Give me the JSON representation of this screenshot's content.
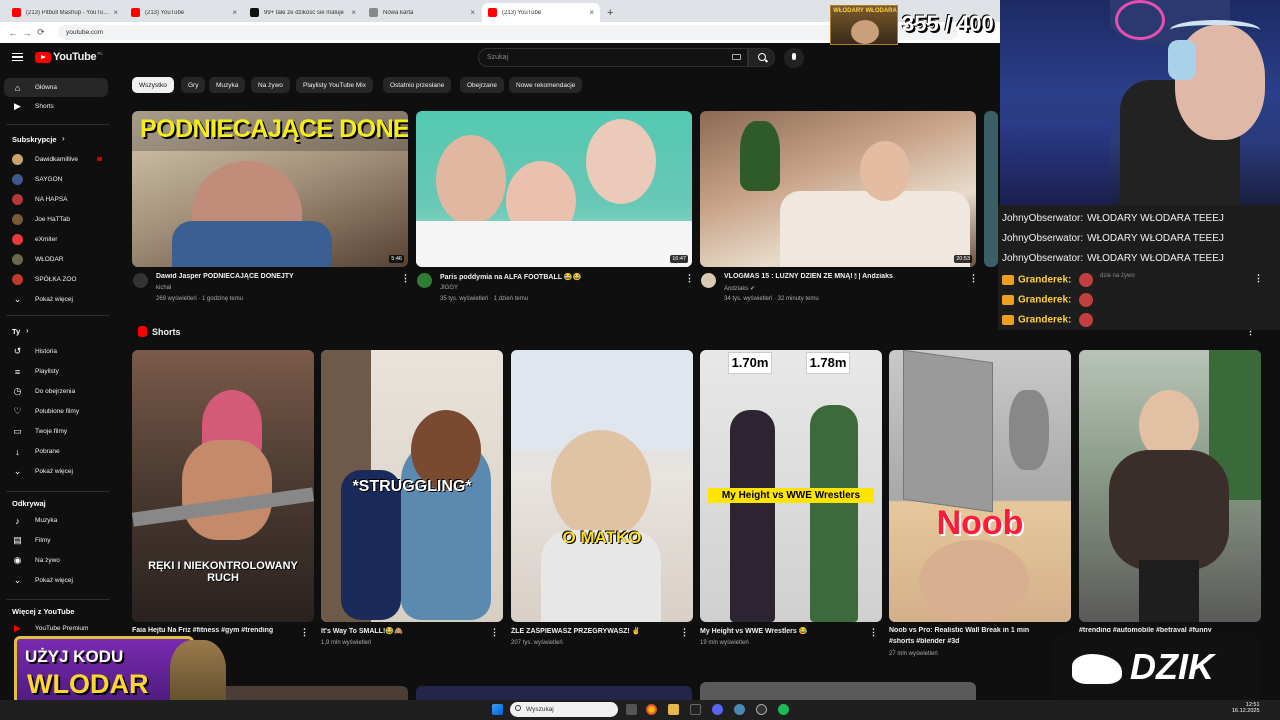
{
  "browser": {
    "tabs": [
      {
        "title": "(213) Pitbull Mashup - YouTube",
        "favicon_color": "#ff0000"
      },
      {
        "title": "(213) YouTube",
        "favicon_color": "#ff0000"
      },
      {
        "title": "99+ tale ze dzikość sie maluje",
        "favicon_color": "#111111"
      },
      {
        "title": "Nowa karta",
        "favicon_color": "#888888"
      },
      {
        "title": "(213) YouTube",
        "favicon_color": "#ff0000"
      }
    ],
    "new_tab_label": "+",
    "url": "youtube.com"
  },
  "youtube": {
    "logo_text": "YouTube",
    "country": "PL",
    "search_placeholder": "Szukaj"
  },
  "sidebar": {
    "main": [
      {
        "label": "Główna",
        "icon": "home-icon"
      },
      {
        "label": "Shorts",
        "icon": "shorts-icon"
      }
    ],
    "subscriptions_header": "Subskrypcje",
    "subscriptions": [
      {
        "label": "Dawidkamillive",
        "color": "#caa26b"
      },
      {
        "label": "SAYGON",
        "color": "#3d5a8c"
      },
      {
        "label": "NA HAPSA",
        "color": "#b33a3a"
      },
      {
        "label": "Joe HaTTab",
        "color": "#7a5a3a"
      },
      {
        "label": "eXmiter",
        "color": "#e23a3a"
      },
      {
        "label": "WŁODAR",
        "color": "#6a6a4a"
      },
      {
        "label": "SPÓŁKA ZOO",
        "color": "#c0392b"
      }
    ],
    "show_more_1": "Pokaż więcej",
    "you_header": "Ty",
    "you_items": [
      {
        "label": "Historia",
        "icon": "history-icon"
      },
      {
        "label": "Playlisty",
        "icon": "playlist-icon"
      },
      {
        "label": "Do obejrzenia",
        "icon": "watch-later-icon"
      },
      {
        "label": "Polubione filmy",
        "icon": "like-icon"
      },
      {
        "label": "Twoje filmy",
        "icon": "your-videos-icon"
      },
      {
        "label": "Pobrane",
        "icon": "download-icon"
      },
      {
        "label": "Pokaż więcej",
        "icon": "chevron-down-icon"
      }
    ],
    "explore_header": "Odkrywaj",
    "explore_items": [
      {
        "label": "Muzyka",
        "icon": "music-icon"
      },
      {
        "label": "Filmy",
        "icon": "film-icon"
      },
      {
        "label": "Na żywo",
        "icon": "live-icon"
      },
      {
        "label": "Pokaż więcej",
        "icon": "chevron-down-icon"
      }
    ],
    "more_header": "Więcej z YouTube",
    "more_items": [
      {
        "label": "YouTube Premium",
        "icon": "premium-icon"
      }
    ]
  },
  "chips": [
    "Wszystko",
    "Gry",
    "Muzyka",
    "Na żywo",
    "Playlisty YouTube Mix",
    "Ostatnio przesłane",
    "Obejrzane",
    "Nowe rekomendacje"
  ],
  "videos": [
    {
      "title": "Dawid Jasper PODNIECAJĄCE DONEJTY",
      "channel": "kichal",
      "meta": "269 wyświetleń · 1 godzinę temu",
      "duration": "5:46",
      "thumb_text": "PODNIECAJĄCE DONEJTY",
      "avatar_color": "#333333"
    },
    {
      "title": "Paris poddymia na ALFA FOOTBALL 😂😂",
      "channel": "JIGGY",
      "meta": "35 tys. wyświetleń · 1 dzień temu",
      "duration": "16:47",
      "thumb_text": "",
      "avatar_color": "#2e7d32"
    },
    {
      "title": "VLOGMAS 15 : LUŹNY DZIEŃ ZE MNĄ! 🕯 | Andziaks",
      "channel": "Andziaks ✔",
      "meta": "34 tys. wyświetleń · 32 minuty temu",
      "duration": "20:53",
      "thumb_text": "",
      "avatar_color": "#d9c9b0"
    }
  ],
  "shorts_header": "Shorts",
  "shorts": [
    {
      "title": "Faia Hejtu Na Friz #fitness #gym #trending",
      "meta": "",
      "caption": "RĘKI I NIEKONTROLOWANY RUCH"
    },
    {
      "title": "It's Way To SMALL!😂🙈",
      "meta": "1,9 mln wyświetleń",
      "caption": "*STRUGGLING*"
    },
    {
      "title": "ŻLE ZAŚPIEWASZ PRZEGRYWASZ! ✌",
      "meta": "207 tys. wyświetleń",
      "caption": "O MATKO"
    },
    {
      "title": "My Height vs WWE Wrestlers 😂",
      "meta": "19 mln wyświetleń",
      "caption": "My Height vs WWE Wrestlers",
      "label1": "1.70m",
      "label2": "1.78m"
    },
    {
      "title": "Noob vs Pro: Realistic Wall Break in 1 min",
      "title2": "#shorts #blender #3d",
      "meta": "27 mln wyświetleń",
      "caption": "Noob"
    },
    {
      "title": "#trending #automobile #betrayal #funny",
      "meta": "",
      "caption": ""
    }
  ],
  "overlay": {
    "counter": "355 / 400",
    "counter_badge": "WŁODARY WŁODARA",
    "chat": [
      {
        "user": "JohnyObserwator:",
        "text": "WŁODARY WŁODARA TEEEJ"
      },
      {
        "user": "JohnyObserwator:",
        "text": "WŁODARY WŁODARA TEEEJ"
      },
      {
        "user": "JohnyObserwator:",
        "text": "WŁODARY WŁODARA TEEEJ"
      },
      {
        "user": "Granderek:",
        "text": ""
      },
      {
        "user": "Granderek:",
        "text": ""
      },
      {
        "user": "Granderek:",
        "text": ""
      }
    ],
    "chat_side_note": "dzie na żywo",
    "promo_line1": "UŻYJ KODU",
    "promo_line2": "WLODAR",
    "sponsor": "DZIK"
  },
  "taskbar": {
    "search_placeholder": "Wyszukaj",
    "time": "12:51",
    "date": "16.12.2025"
  }
}
